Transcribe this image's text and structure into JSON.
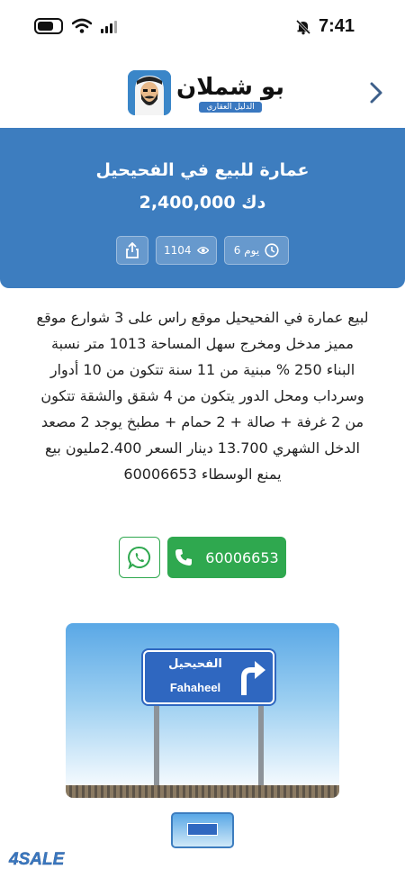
{
  "status_bar": {
    "time": "7:41"
  },
  "header": {
    "logo_title": "بو شملان",
    "logo_subtitle": "الدليل العقاري"
  },
  "listing": {
    "title": "عمارة للبيع في الفحيحيل",
    "price": "2,400,000 دك",
    "age": "6 يوم",
    "views": "1104",
    "description": "لبيع عمارة في الفحيحيل موقع راس على 3 شوارع موقع مميز مدخل ومخرج سهل المساحة 1013 متر نسبة البناء 250 % مبنية من 11 سنة تتكون من 10 أدوار وسرداب ومحل الدور يتكون من 4 شقق والشقة تتكون من 2 غرفة + صالة + 2 حمام + مطبخ يوجد 2 مصعد الدخل الشهري 13.700 دينار السعر 2.400مليون بيع يمنع الوسطاء 60006653"
  },
  "contact": {
    "phone": "60006653"
  },
  "photo": {
    "sign_arabic": "الفحيحيل",
    "sign_english": "Fahaheel"
  },
  "watermark": {
    "brand": "4SALE"
  },
  "colors": {
    "banner": "#3d7dbf",
    "call_green": "#2fa84f",
    "sign_blue": "#2f67c0"
  },
  "icons": [
    "battery-icon",
    "wifi-icon",
    "signal-icon",
    "bell-off-icon",
    "chevron-right-icon",
    "share-icon",
    "eye-icon",
    "clock-icon",
    "whatsapp-icon",
    "phone-icon"
  ]
}
